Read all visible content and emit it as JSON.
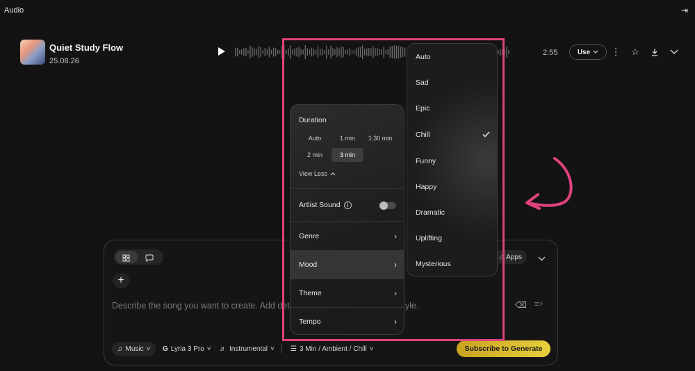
{
  "app": {
    "title": "Audio",
    "collapse_icon": "collapse-panel-icon"
  },
  "track": {
    "title": "Quiet Study Flow",
    "date": "25.08.26",
    "duration": "2:55",
    "use_label": "Use"
  },
  "prompt": {
    "placeholder_left": "Describe the song you want to create. Add det",
    "placeholder_right": "yle.",
    "apps_label": "Apps",
    "chips": {
      "music": "Music",
      "model": "Lyria 3 Pro",
      "instrumental": "Instrumental",
      "settings": "3 Min / Ambient / Chill"
    },
    "generate_label": "Subscribe to Generate"
  },
  "settings": {
    "duration_label": "Duration",
    "durations": [
      "Auto",
      "1 min",
      "1:30 min",
      "2 min",
      "3 min"
    ],
    "selected_duration": "3 min",
    "view_less": "View Less",
    "artist_sound": "Artlist Sound",
    "artist_sound_on": false,
    "menu": [
      {
        "label": "Genre"
      },
      {
        "label": "Mood"
      },
      {
        "label": "Theme"
      },
      {
        "label": "Tempo"
      }
    ],
    "active_menu": "Mood"
  },
  "mood_options": [
    "Auto",
    "Sad",
    "Epic",
    "Chill",
    "Funny",
    "Happy",
    "Dramatic",
    "Uplifting",
    "Mysterious"
  ],
  "selected_mood": "Chill",
  "colors": {
    "highlight": "#e0427f",
    "generate_button": "#e0c53a",
    "background": "#131313"
  }
}
